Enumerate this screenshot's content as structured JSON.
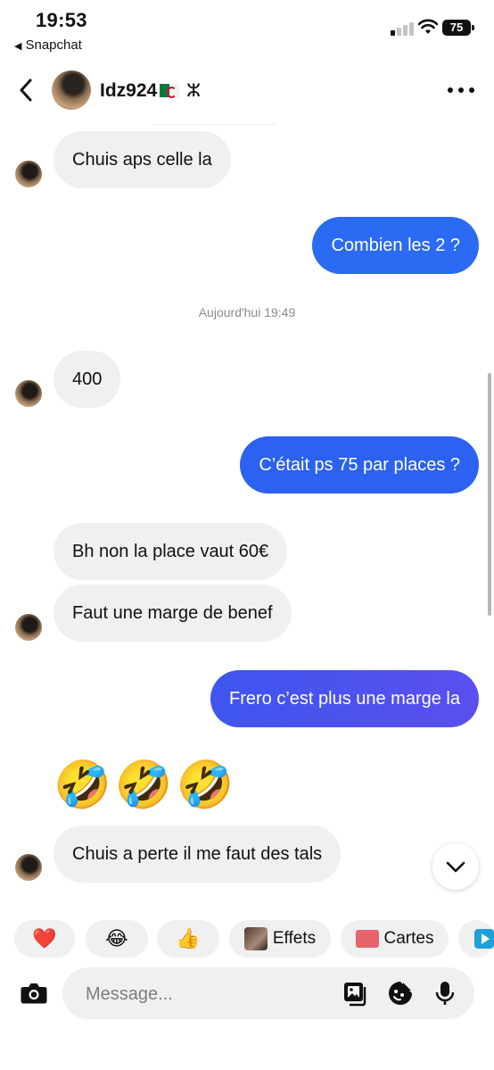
{
  "status": {
    "time": "19:53",
    "back_app": "Snapchat",
    "battery": "75"
  },
  "header": {
    "contact_name": "Idz924",
    "suffix_symbol": "ⵣ"
  },
  "messages": [
    {
      "side": "received",
      "text": "Chuis aps celle la",
      "avatar": true
    },
    {
      "side": "sent",
      "text": "Combien les 2 ?"
    },
    {
      "side": "timestamp",
      "text": "Aujourd'hui 19:49"
    },
    {
      "side": "received",
      "text": "400",
      "avatar": true
    },
    {
      "side": "sent",
      "text": "C’était ps 75 par places ?"
    },
    {
      "side": "received",
      "text": "Bh non la place vaut 60€",
      "avatar": false
    },
    {
      "side": "received",
      "text": "Faut une marge de benef",
      "avatar": true
    },
    {
      "side": "sent",
      "text": "Frero c’est plus une marge la"
    },
    {
      "side": "received",
      "text": "🤣🤣🤣",
      "avatar": false
    },
    {
      "side": "received",
      "text": "Chuis a perte il me faut des tals",
      "avatar": true
    }
  ],
  "chips": [
    {
      "icon": "❤️",
      "label": ""
    },
    {
      "icon": "😂",
      "label": ""
    },
    {
      "icon": "👍",
      "label": ""
    },
    {
      "icon": "effects-thumbnail",
      "label": "Effets"
    },
    {
      "icon": "card-icon",
      "label": "Cartes"
    },
    {
      "icon": "play-icon",
      "label": ""
    }
  ],
  "composer": {
    "placeholder": "Message..."
  },
  "colors": {
    "sent_top": "#2a6cf3",
    "sent_bottom": "#5a55f0",
    "received_bg": "#f0f0f1"
  }
}
